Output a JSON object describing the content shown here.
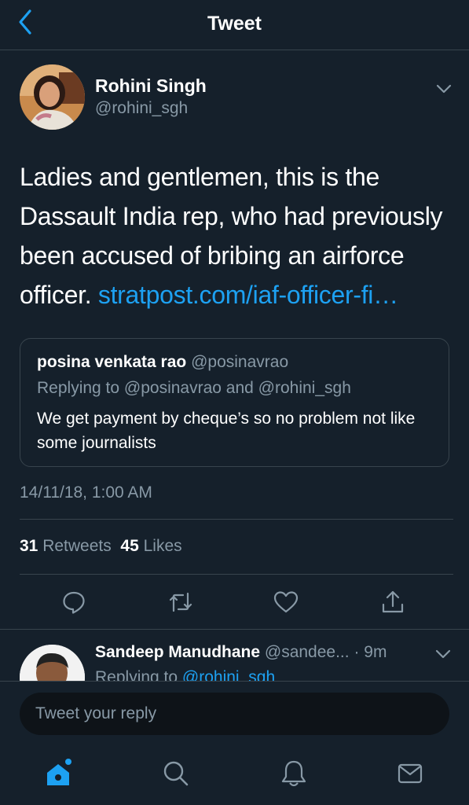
{
  "header": {
    "title": "Tweet"
  },
  "tweet": {
    "author_name": "Rohini Singh",
    "author_handle": "@rohini_sgh",
    "text": "Ladies and gentlemen, this is the Dassault India rep, who had previously been accused of bribing an airforce officer.",
    "link_text": "stratpost.com/iaf-officer-fi…",
    "timestamp": "14/11/18, 1:00 AM",
    "retweets_count": "31",
    "retweets_label": "Retweets",
    "likes_count": "45",
    "likes_label": "Likes"
  },
  "quote": {
    "name": "posina venkata rao",
    "handle": "@posinavrao",
    "replying": "Replying to @posinavrao and @rohini_sgh",
    "text": "We get payment by cheque’s so no problem not like some journalists"
  },
  "reply": {
    "name": "Sandeep Manudhane",
    "handle_trunc": "@sandee...",
    "time": "· 9m",
    "replying_prefix": "Replying to",
    "replying_mention": "@rohini_sgh"
  },
  "compose": {
    "placeholder": "Tweet your reply"
  },
  "icons": [
    "back-chevron-icon",
    "caret-down-icon",
    "reply-icon",
    "retweet-icon",
    "like-icon",
    "share-icon",
    "home-icon",
    "search-icon",
    "notifications-icon",
    "messages-icon"
  ],
  "colors": {
    "background": "#15202b",
    "accent": "#1da1f2",
    "secondary_text": "#8899a6",
    "border": "#38444d"
  }
}
